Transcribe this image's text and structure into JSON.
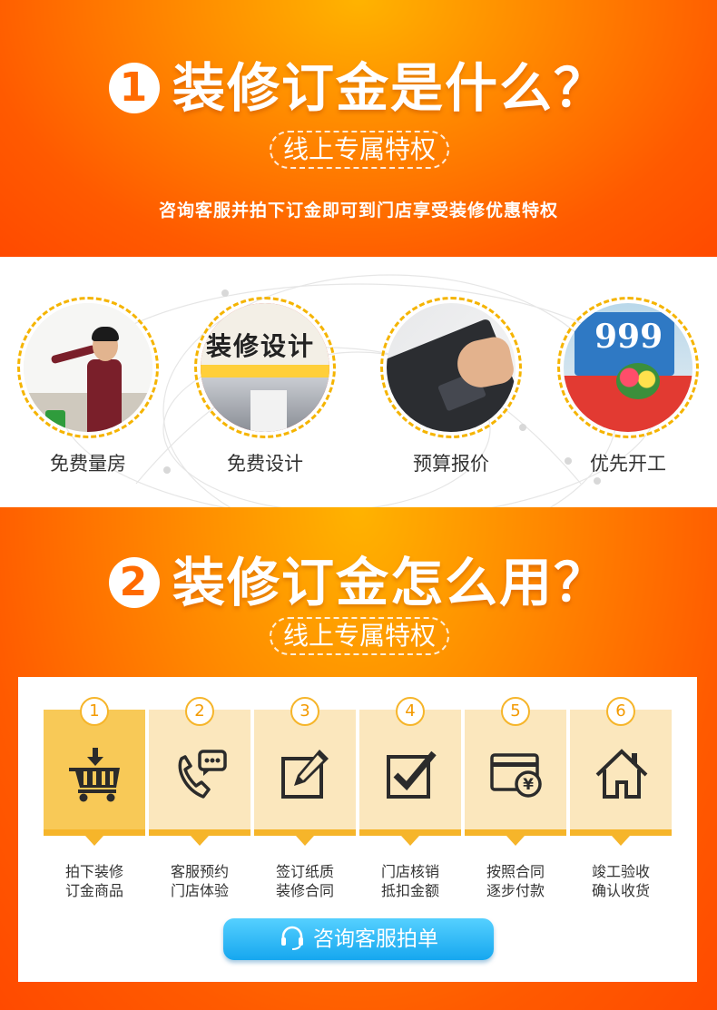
{
  "section1": {
    "number": "1",
    "title": "装修订金是什么？",
    "pill": "线上专属特权",
    "subtitle": "咨询客服并拍下订金即可到门店享受装修优惠特权"
  },
  "features": [
    {
      "label": "免费量房",
      "icon": "measure-room-photo"
    },
    {
      "label": "免费设计",
      "icon": "design-shop-photo",
      "sign_text": "装修设计"
    },
    {
      "label": "预算报价",
      "icon": "laptop-photo"
    },
    {
      "label": "优先开工",
      "icon": "opening-event-photo",
      "sign_text": "999"
    }
  ],
  "section2": {
    "number": "2",
    "title": "装修订金怎么用？",
    "pill": "线上专属特权"
  },
  "steps": [
    {
      "num": "1",
      "line1": "拍下装修",
      "line2": "订金商品",
      "icon": "shopping-cart-icon"
    },
    {
      "num": "2",
      "line1": "客服预约",
      "line2": "门店体验",
      "icon": "phone-chat-icon"
    },
    {
      "num": "3",
      "line1": "签订纸质",
      "line2": "装修合同",
      "icon": "edit-icon"
    },
    {
      "num": "4",
      "line1": "门店核销",
      "line2": "抵扣金额",
      "icon": "checkbox-icon"
    },
    {
      "num": "5",
      "line1": "按照合同",
      "line2": "逐步付款",
      "icon": "payment-card-icon",
      "symbol": "¥"
    },
    {
      "num": "6",
      "line1": "竣工验收",
      "line2": "确认收货",
      "icon": "home-icon"
    }
  ],
  "cta": {
    "label": "咨询客服拍单"
  },
  "colors": {
    "orange": "#ff6a00",
    "step_active": "#f8c957",
    "step_inactive": "#fbe7bd",
    "accent": "#f6b52a",
    "cta": "#16a7ef"
  }
}
